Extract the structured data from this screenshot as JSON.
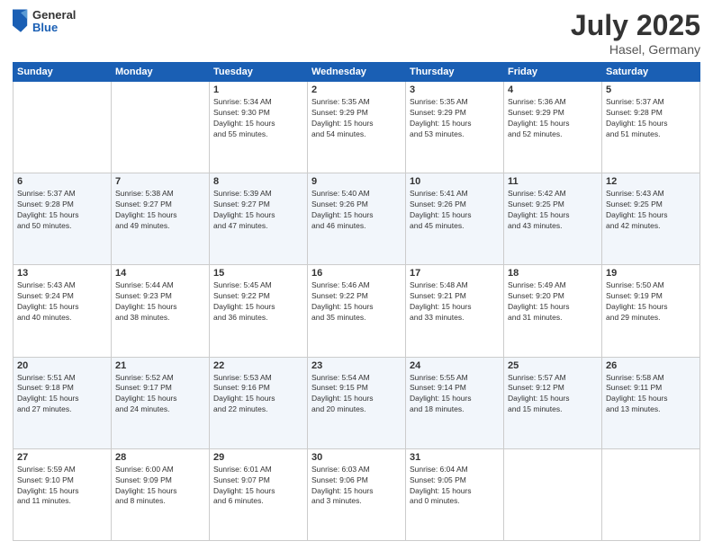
{
  "header": {
    "logo_general": "General",
    "logo_blue": "Blue",
    "month_title": "July 2025",
    "location": "Hasel, Germany"
  },
  "days_of_week": [
    "Sunday",
    "Monday",
    "Tuesday",
    "Wednesday",
    "Thursday",
    "Friday",
    "Saturday"
  ],
  "weeks": [
    [
      {
        "day": "",
        "info": ""
      },
      {
        "day": "",
        "info": ""
      },
      {
        "day": "1",
        "info": "Sunrise: 5:34 AM\nSunset: 9:30 PM\nDaylight: 15 hours\nand 55 minutes."
      },
      {
        "day": "2",
        "info": "Sunrise: 5:35 AM\nSunset: 9:29 PM\nDaylight: 15 hours\nand 54 minutes."
      },
      {
        "day": "3",
        "info": "Sunrise: 5:35 AM\nSunset: 9:29 PM\nDaylight: 15 hours\nand 53 minutes."
      },
      {
        "day": "4",
        "info": "Sunrise: 5:36 AM\nSunset: 9:29 PM\nDaylight: 15 hours\nand 52 minutes."
      },
      {
        "day": "5",
        "info": "Sunrise: 5:37 AM\nSunset: 9:28 PM\nDaylight: 15 hours\nand 51 minutes."
      }
    ],
    [
      {
        "day": "6",
        "info": "Sunrise: 5:37 AM\nSunset: 9:28 PM\nDaylight: 15 hours\nand 50 minutes."
      },
      {
        "day": "7",
        "info": "Sunrise: 5:38 AM\nSunset: 9:27 PM\nDaylight: 15 hours\nand 49 minutes."
      },
      {
        "day": "8",
        "info": "Sunrise: 5:39 AM\nSunset: 9:27 PM\nDaylight: 15 hours\nand 47 minutes."
      },
      {
        "day": "9",
        "info": "Sunrise: 5:40 AM\nSunset: 9:26 PM\nDaylight: 15 hours\nand 46 minutes."
      },
      {
        "day": "10",
        "info": "Sunrise: 5:41 AM\nSunset: 9:26 PM\nDaylight: 15 hours\nand 45 minutes."
      },
      {
        "day": "11",
        "info": "Sunrise: 5:42 AM\nSunset: 9:25 PM\nDaylight: 15 hours\nand 43 minutes."
      },
      {
        "day": "12",
        "info": "Sunrise: 5:43 AM\nSunset: 9:25 PM\nDaylight: 15 hours\nand 42 minutes."
      }
    ],
    [
      {
        "day": "13",
        "info": "Sunrise: 5:43 AM\nSunset: 9:24 PM\nDaylight: 15 hours\nand 40 minutes."
      },
      {
        "day": "14",
        "info": "Sunrise: 5:44 AM\nSunset: 9:23 PM\nDaylight: 15 hours\nand 38 minutes."
      },
      {
        "day": "15",
        "info": "Sunrise: 5:45 AM\nSunset: 9:22 PM\nDaylight: 15 hours\nand 36 minutes."
      },
      {
        "day": "16",
        "info": "Sunrise: 5:46 AM\nSunset: 9:22 PM\nDaylight: 15 hours\nand 35 minutes."
      },
      {
        "day": "17",
        "info": "Sunrise: 5:48 AM\nSunset: 9:21 PM\nDaylight: 15 hours\nand 33 minutes."
      },
      {
        "day": "18",
        "info": "Sunrise: 5:49 AM\nSunset: 9:20 PM\nDaylight: 15 hours\nand 31 minutes."
      },
      {
        "day": "19",
        "info": "Sunrise: 5:50 AM\nSunset: 9:19 PM\nDaylight: 15 hours\nand 29 minutes."
      }
    ],
    [
      {
        "day": "20",
        "info": "Sunrise: 5:51 AM\nSunset: 9:18 PM\nDaylight: 15 hours\nand 27 minutes."
      },
      {
        "day": "21",
        "info": "Sunrise: 5:52 AM\nSunset: 9:17 PM\nDaylight: 15 hours\nand 24 minutes."
      },
      {
        "day": "22",
        "info": "Sunrise: 5:53 AM\nSunset: 9:16 PM\nDaylight: 15 hours\nand 22 minutes."
      },
      {
        "day": "23",
        "info": "Sunrise: 5:54 AM\nSunset: 9:15 PM\nDaylight: 15 hours\nand 20 minutes."
      },
      {
        "day": "24",
        "info": "Sunrise: 5:55 AM\nSunset: 9:14 PM\nDaylight: 15 hours\nand 18 minutes."
      },
      {
        "day": "25",
        "info": "Sunrise: 5:57 AM\nSunset: 9:12 PM\nDaylight: 15 hours\nand 15 minutes."
      },
      {
        "day": "26",
        "info": "Sunrise: 5:58 AM\nSunset: 9:11 PM\nDaylight: 15 hours\nand 13 minutes."
      }
    ],
    [
      {
        "day": "27",
        "info": "Sunrise: 5:59 AM\nSunset: 9:10 PM\nDaylight: 15 hours\nand 11 minutes."
      },
      {
        "day": "28",
        "info": "Sunrise: 6:00 AM\nSunset: 9:09 PM\nDaylight: 15 hours\nand 8 minutes."
      },
      {
        "day": "29",
        "info": "Sunrise: 6:01 AM\nSunset: 9:07 PM\nDaylight: 15 hours\nand 6 minutes."
      },
      {
        "day": "30",
        "info": "Sunrise: 6:03 AM\nSunset: 9:06 PM\nDaylight: 15 hours\nand 3 minutes."
      },
      {
        "day": "31",
        "info": "Sunrise: 6:04 AM\nSunset: 9:05 PM\nDaylight: 15 hours\nand 0 minutes."
      },
      {
        "day": "",
        "info": ""
      },
      {
        "day": "",
        "info": ""
      }
    ]
  ]
}
